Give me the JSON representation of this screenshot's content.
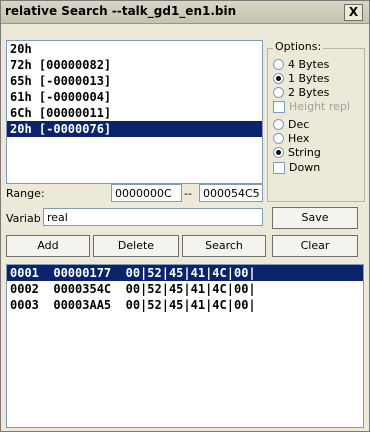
{
  "window": {
    "title": "relative Search --talk_gd1_en1.bin",
    "close_label": "X"
  },
  "results": [
    {
      "text": "20h",
      "selected": false
    },
    {
      "text": "72h [00000082]",
      "selected": false
    },
    {
      "text": "65h [-0000013]",
      "selected": false
    },
    {
      "text": "61h [-0000004]",
      "selected": false
    },
    {
      "text": "6Ch [00000011]",
      "selected": false
    },
    {
      "text": "20h [-0000076]",
      "selected": true
    }
  ],
  "options": {
    "legend": "Options:",
    "width": [
      {
        "label": "4 Bytes",
        "checked": false
      },
      {
        "label": "1 Bytes",
        "checked": true
      },
      {
        "label": "2 Bytes",
        "checked": false
      }
    ],
    "height_repl": {
      "label": "Height repl",
      "checked": false,
      "disabled": true
    },
    "mode": [
      {
        "label": "Dec",
        "checked": false
      },
      {
        "label": "Hex",
        "checked": false
      },
      {
        "label": "String",
        "checked": true
      }
    ],
    "down": {
      "label": "Down",
      "checked": false
    }
  },
  "range": {
    "label": "Range:",
    "from": "0000000C",
    "sep": "--",
    "to": "000054C5"
  },
  "variab": {
    "label": "Variab",
    "value": "real"
  },
  "buttons": {
    "save": "Save",
    "add": "Add",
    "delete": "Delete",
    "search": "Search",
    "clear": "Clear"
  },
  "grid_rows": [
    {
      "text": "0001  00000177  00|52|45|41|4C|00|",
      "selected": true
    },
    {
      "text": "0002  0000354C  00|52|45|41|4C|00|",
      "selected": false
    },
    {
      "text": "0003  00003AA5  00|52|45|41|4C|00|",
      "selected": false
    }
  ]
}
